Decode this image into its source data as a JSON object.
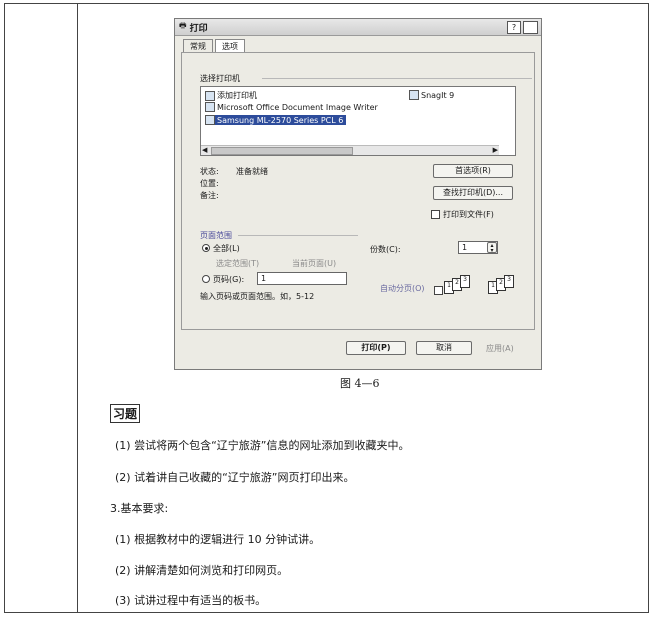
{
  "dialog": {
    "title": "打印",
    "help_label": "?",
    "tabs": [
      "常规",
      "选项"
    ],
    "select_printer_label": "选择打印机",
    "printers": {
      "add_printer": "添加打印机",
      "snagit": "SnagIt 9",
      "ms_image_writer": "Microsoft Office Document Image Writer",
      "samsung": "Samsung ML-2570 Series PCL 6"
    },
    "status_label": "状态:",
    "status_value": "准备就绪",
    "location_label": "位置:",
    "comment_label": "备注:",
    "preferences_button": "首选项(R)",
    "find_printer_button": "查找打印机(D)...",
    "print_to_file_label": "打印到文件(F)",
    "page_range_label": "页面范围",
    "all_label": "全部(L)",
    "selection_label": "选定范围(T)",
    "current_page_label": "当前页面(U)",
    "pages_label": "页码(G):",
    "pages_value": "1",
    "pages_hint": "输入页码或页面范围。如，5-12",
    "copies_label": "份数(C):",
    "copies_value": "1",
    "collate_label": "自动分页(O)",
    "print_button": "打印(P)",
    "cancel_button": "取消",
    "apply_button": "应用(A)"
  },
  "caption": "图 4—6",
  "exercise_heading": "习题",
  "lines": [
    "(1) 尝试将两个包含“辽宁旅游”信息的网址添加到收藏夹中。",
    "(2) 试着讲自己收藏的“辽宁旅游”网页打印出来。",
    "3.基本要求:",
    "(1) 根据教材中的逻辑进行 10 分钟试讲。",
    "(2) 讲解清楚如何浏览和打印网页。",
    "(3) 试讲过程中有适当的板书。"
  ]
}
